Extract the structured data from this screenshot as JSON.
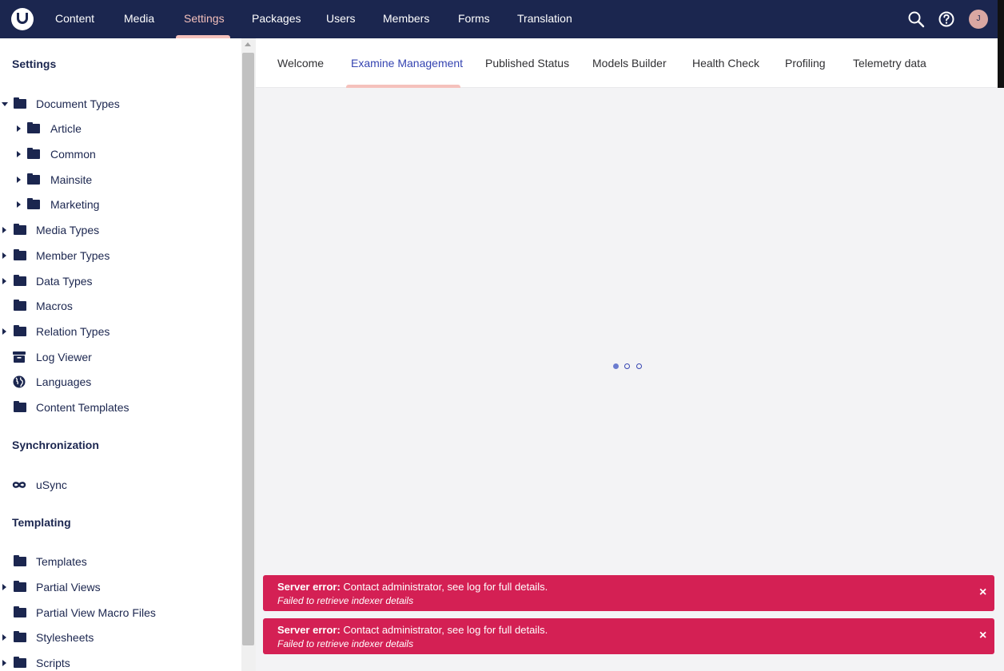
{
  "header": {
    "logo_icon": "umbraco-logo-icon",
    "nav": [
      {
        "label": "Content"
      },
      {
        "label": "Media"
      },
      {
        "label": "Settings",
        "active": true
      },
      {
        "label": "Packages"
      },
      {
        "label": "Users"
      },
      {
        "label": "Members"
      },
      {
        "label": "Forms"
      },
      {
        "label": "Translation"
      }
    ],
    "search_icon": "search-icon",
    "help_icon": "help-icon",
    "avatar_initial": "J"
  },
  "sidebar": {
    "settings_heading": "Settings",
    "settings_items": [
      {
        "label": "Document Types",
        "icon": "folder-icon",
        "expanded": true
      },
      {
        "label": "Article",
        "icon": "folder-icon"
      },
      {
        "label": "Common",
        "icon": "folder-icon"
      },
      {
        "label": "Mainsite",
        "icon": "folder-icon"
      },
      {
        "label": "Marketing",
        "icon": "folder-icon"
      },
      {
        "label": "Media Types",
        "icon": "folder-icon"
      },
      {
        "label": "Member Types",
        "icon": "folder-icon"
      },
      {
        "label": "Data Types",
        "icon": "folder-icon"
      },
      {
        "label": "Macros",
        "icon": "folder-icon"
      },
      {
        "label": "Relation Types",
        "icon": "folder-icon"
      },
      {
        "label": "Log Viewer",
        "icon": "archive-icon"
      },
      {
        "label": "Languages",
        "icon": "globe-icon"
      },
      {
        "label": "Content Templates",
        "icon": "folder-icon"
      }
    ],
    "sync_heading": "Synchronization",
    "sync_items": [
      {
        "label": "uSync",
        "icon": "infinity-icon"
      }
    ],
    "templating_heading": "Templating",
    "templating_items": [
      {
        "label": "Templates",
        "icon": "folder-icon"
      },
      {
        "label": "Partial Views",
        "icon": "folder-icon"
      },
      {
        "label": "Partial View Macro Files",
        "icon": "folder-icon"
      },
      {
        "label": "Stylesheets",
        "icon": "folder-icon"
      },
      {
        "label": "Scripts",
        "icon": "folder-icon"
      }
    ]
  },
  "tabs": [
    {
      "label": "Welcome"
    },
    {
      "label": "Examine Management",
      "active": true
    },
    {
      "label": "Published Status"
    },
    {
      "label": "Models Builder"
    },
    {
      "label": "Health Check"
    },
    {
      "label": "Profiling"
    },
    {
      "label": "Telemetry data"
    }
  ],
  "notifications": [
    {
      "title": "Server error:",
      "message": "Contact administrator, see log for full details.",
      "detail": "Failed to retrieve indexer details",
      "close": "×"
    },
    {
      "title": "Server error:",
      "message": "Contact administrator, see log for full details.",
      "detail": "Failed to retrieve indexer details",
      "close": "×"
    }
  ],
  "colors": {
    "header_bg": "#1b264f",
    "accent": "#f5c1bc",
    "active_tab": "#3544b1",
    "error_bg": "#d42054"
  }
}
